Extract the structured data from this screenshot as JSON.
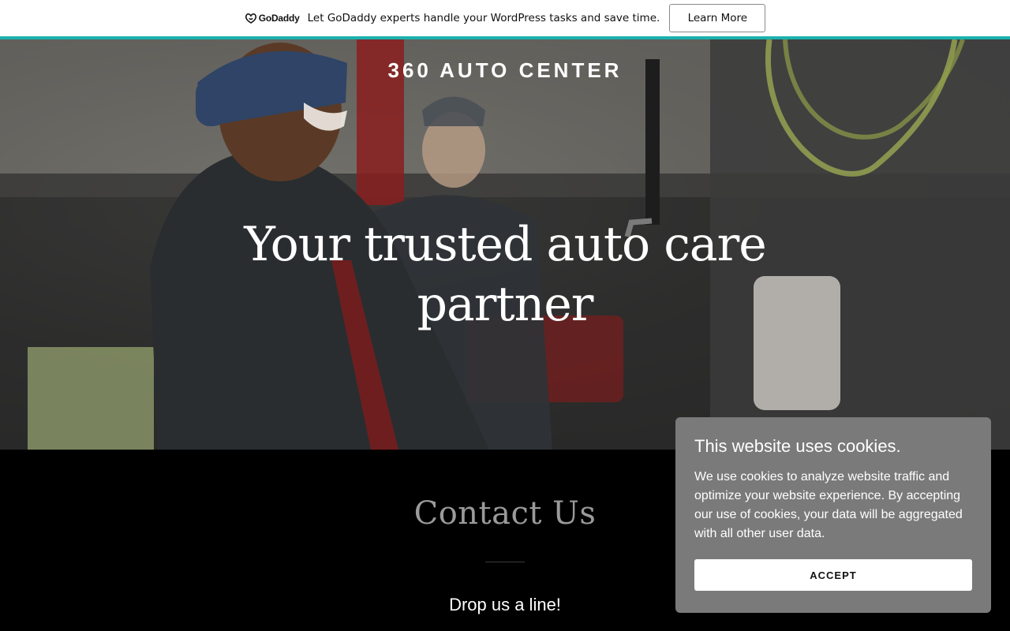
{
  "promo": {
    "logo_text": "GoDaddy",
    "message": "Let GoDaddy experts handle your WordPress tasks and save time.",
    "cta_label": "Learn More",
    "accent_color": "#1bb1ad"
  },
  "hero": {
    "brand": "360 AUTO CENTER",
    "headline": "Your trusted auto care partner",
    "image": "photo of smiling mechanics in an auto repair garage"
  },
  "contact": {
    "title": "Contact Us",
    "subtitle": "Drop us a line!"
  },
  "cookie_banner": {
    "title": "This website uses cookies.",
    "body": "We use cookies to analyze website traffic and optimize your website experience. By accepting our use of cookies, your data will be aggregated with all other user data.",
    "accept_label": "ACCEPT"
  },
  "icons": {
    "logo": "godaddy-logo-icon"
  }
}
